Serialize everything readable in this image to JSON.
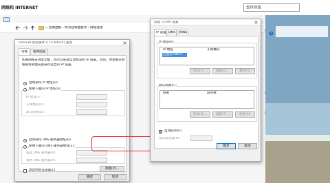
{
  "colors": {
    "highlight": "#e4312b",
    "selection": "#3f8fde",
    "accent": "#0078d7"
  },
  "explorer": {
    "title": "网络和 INTERNET",
    "search_placeholder": "查找设置",
    "path": "控制面板 › 所有控制面板项 › 网络连接",
    "path_prefix": "»",
    "icons": {
      "back": "back-arrow-icon",
      "forward": "forward-arrow-icon",
      "up": "up-arrow-icon",
      "refresh": "refresh-icon",
      "search": "search-icon",
      "help": "help-icon",
      "window": "window-icon"
    }
  },
  "ipv4": {
    "window_title": "Internet 协议版本 4 (TCP/IPv4) 属性",
    "tabs": [
      "常规",
      "备用配置"
    ],
    "intro_line1": "如果网络支持此功能，则可以获取自动指派的 IP 设置。否则，你需要从网",
    "intro_line2": "络系统管理员处获得适当的 IP 设置。",
    "auto_ip": "自动获得 IP 地址(O)",
    "manual_ip": "使用下面的 IP 地址(S):",
    "ip_address": "IP 地址(I):",
    "subnet_mask": "子网掩码(U):",
    "gateway": "默认网关(D):",
    "auto_dns": "自动获得 DNS 服务器地址(B)",
    "manual_dns": "使用下面的 DNS 服务器地址(E):",
    "preferred_dns": "首选 DNS 服务器(P):",
    "alternate_dns": "备用 DNS 服务器(A):",
    "validate": "退出时验证设置(L)",
    "advanced": "高级(V)...",
    "ok": "确定",
    "cancel": "取消"
  },
  "tcpip": {
    "window_title": "高级 TCP/IP 设置",
    "tabs": [
      "IP 设置",
      "DNS",
      "WINS"
    ],
    "ip_group": "IP 地址(R)",
    "col_ip": "IP 地址",
    "col_subnet": "子网掩码",
    "dhcp_entry": "已启用 DHCP",
    "add1": "添加(A)...",
    "edit1": "编辑(E)...",
    "delete1": "删除(V)",
    "gw_group": "默认网关(F):",
    "col_gateway": "网关",
    "col_metric": "跃点数",
    "add2": "添加(D)...",
    "edit2": "编辑(T)...",
    "delete2": "删除(M)",
    "auto_metric": "自动跃点(U)",
    "iface_metric": "接口跃点数(N):",
    "ok": "确定",
    "cancel": "取消"
  },
  "help_marks": [
    "?",
    "?",
    "?"
  ]
}
